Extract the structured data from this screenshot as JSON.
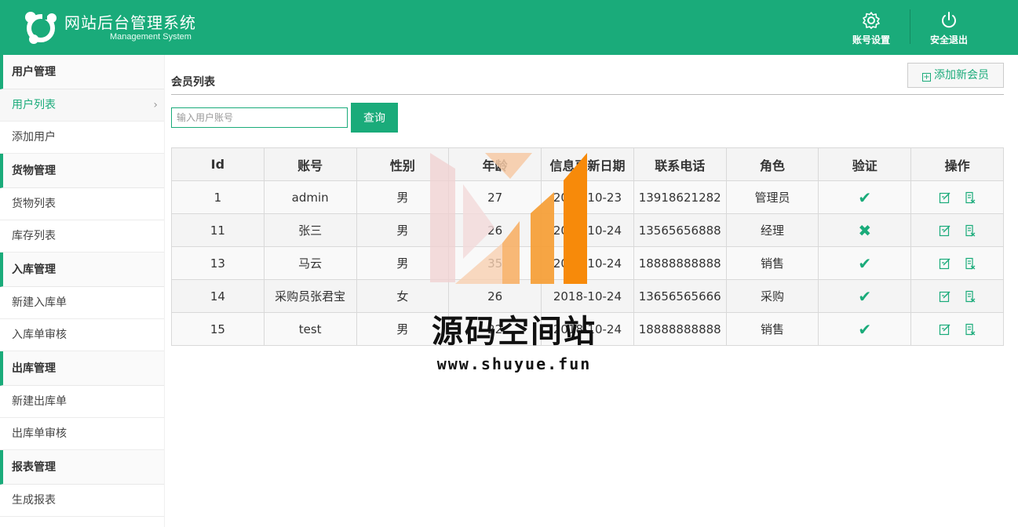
{
  "header": {
    "title": "网站后台管理系统",
    "subtitle": "Management System",
    "account_settings": "账号设置",
    "logout": "安全退出"
  },
  "sidebar": {
    "groups": [
      {
        "label": "用户管理",
        "items": [
          "用户列表",
          "添加用户"
        ]
      },
      {
        "label": "货物管理",
        "items": [
          "货物列表",
          "库存列表"
        ]
      },
      {
        "label": "入库管理",
        "items": [
          "新建入库单",
          "入库单审核"
        ]
      },
      {
        "label": "出库管理",
        "items": [
          "新建出库单",
          "出库单审核"
        ]
      },
      {
        "label": "报表管理",
        "items": [
          "生成报表"
        ]
      }
    ],
    "active_item": "用户列表",
    "chevron": "›"
  },
  "main": {
    "page_title": "会员列表",
    "add_button": "添加新会员",
    "search_placeholder": "输入用户账号",
    "search_button": "查询",
    "columns": [
      "Id",
      "账号",
      "性别",
      "年龄",
      "信息更新日期",
      "联系电话",
      "角色",
      "验证",
      "操作"
    ],
    "rows": [
      {
        "id": "1",
        "account": "admin",
        "gender": "男",
        "age": "27",
        "date": "2018-10-23",
        "phone": "13918621282",
        "role": "管理员",
        "verified": true
      },
      {
        "id": "11",
        "account": "张三",
        "gender": "男",
        "age": "26",
        "date": "2018-10-24",
        "phone": "13565656888",
        "role": "经理",
        "verified": false
      },
      {
        "id": "13",
        "account": "马云",
        "gender": "男",
        "age": "35",
        "date": "2018-10-24",
        "phone": "18888888888",
        "role": "销售",
        "verified": true
      },
      {
        "id": "14",
        "account": "采购员张君宝",
        "gender": "女",
        "age": "26",
        "date": "2018-10-24",
        "phone": "13656565666",
        "role": "采购",
        "verified": true
      },
      {
        "id": "15",
        "account": "test",
        "gender": "男",
        "age": "22",
        "date": "2018-10-24",
        "phone": "18888888888",
        "role": "销售",
        "verified": true
      }
    ],
    "verified_icon": "✔",
    "unverified_icon": "✖"
  },
  "watermark": {
    "text": "源码空间站",
    "url": "www.shuyue.fun"
  },
  "colors": {
    "brand": "#1aab7a",
    "watermark_orange": "#f78a0a"
  }
}
